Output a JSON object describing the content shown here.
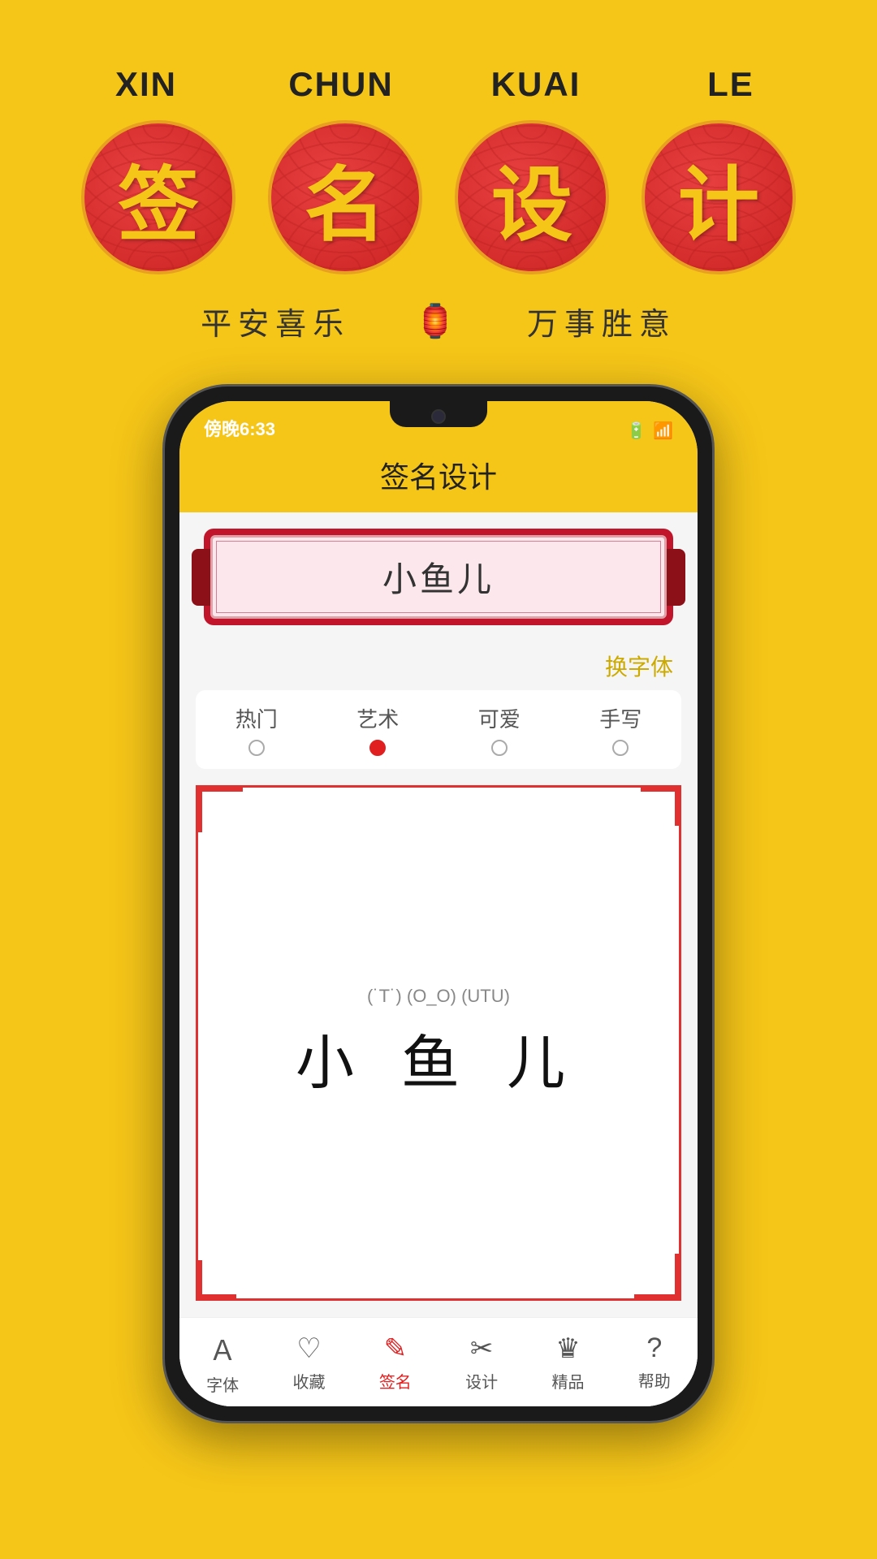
{
  "background": "#F5C518",
  "top": {
    "pinyin": [
      "XIN",
      "CHUN",
      "KUAI",
      "LE"
    ],
    "chars": [
      "签",
      "名",
      "设",
      "计"
    ],
    "subtitle_left": "平安喜乐",
    "subtitle_icon": "🏮",
    "subtitle_right": "万事胜意"
  },
  "phone": {
    "status_time": "傍晚6:33",
    "status_icons": "📶",
    "app_title": "签名设计",
    "scroll_text": "小鱼儿",
    "font_change": "换字体",
    "tabs": [
      {
        "label": "热门",
        "active": false
      },
      {
        "label": "艺术",
        "active": true
      },
      {
        "label": "可爱",
        "active": false
      },
      {
        "label": "手写",
        "active": false
      }
    ],
    "preview_emoticons": "(˙T˙) (O_O) (UTU)",
    "preview_chars": "小 鱼 儿",
    "nav_items": [
      {
        "label": "字体",
        "icon": "A",
        "active": false
      },
      {
        "label": "收藏",
        "icon": "♡",
        "active": false
      },
      {
        "label": "签名",
        "icon": "✎",
        "active": true
      },
      {
        "label": "设计",
        "icon": "✂",
        "active": false
      },
      {
        "label": "精品",
        "icon": "♛",
        "active": false
      },
      {
        "label": "帮助",
        "icon": "?",
        "active": false
      }
    ]
  }
}
